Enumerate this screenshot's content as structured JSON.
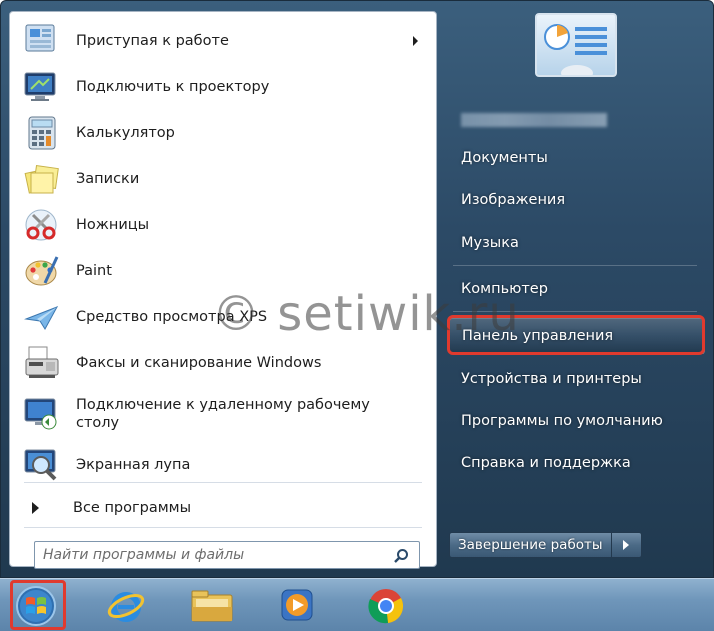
{
  "programs": [
    {
      "label": "Приступая к работе",
      "icon": "getting-started-icon",
      "has_submenu": true
    },
    {
      "label": "Подключить к проектору",
      "icon": "projector-icon",
      "has_submenu": false
    },
    {
      "label": "Калькулятор",
      "icon": "calculator-icon",
      "has_submenu": false
    },
    {
      "label": "Записки",
      "icon": "sticky-notes-icon",
      "has_submenu": false
    },
    {
      "label": "Ножницы",
      "icon": "scissors-icon",
      "has_submenu": false
    },
    {
      "label": "Paint",
      "icon": "paint-palette-icon",
      "has_submenu": false
    },
    {
      "label": "Средство просмотра XPS",
      "icon": "xps-viewer-icon",
      "has_submenu": false
    },
    {
      "label": "Факсы и сканирование Windows",
      "icon": "fax-scanner-icon",
      "has_submenu": false
    },
    {
      "label": "Подключение к удаленному рабочему столу",
      "icon": "remote-desktop-icon",
      "has_submenu": false
    },
    {
      "label": "Экранная лупа",
      "icon": "magnifier-icon",
      "has_submenu": false
    }
  ],
  "all_programs_label": "Все программы",
  "search": {
    "placeholder": "Найти программы и файлы"
  },
  "right_pane": {
    "items": [
      {
        "label": "Документы"
      },
      {
        "label": "Изображения"
      },
      {
        "label": "Музыка"
      },
      {
        "label": "Компьютер"
      },
      {
        "label": "Панель управления",
        "highlighted": true
      },
      {
        "label": "Устройства и принтеры"
      },
      {
        "label": "Программы по умолчанию"
      },
      {
        "label": "Справка и поддержка"
      }
    ]
  },
  "shutdown_label": "Завершение работы",
  "watermark": "© setiwik.ru",
  "taskbar": {
    "icons": [
      "windows-start-orb-icon",
      "internet-explorer-icon",
      "file-explorer-icon",
      "media-player-icon",
      "chrome-icon"
    ]
  },
  "colors": {
    "highlight_box": "#e03a2e",
    "menu_bg": "#2c4a66"
  }
}
